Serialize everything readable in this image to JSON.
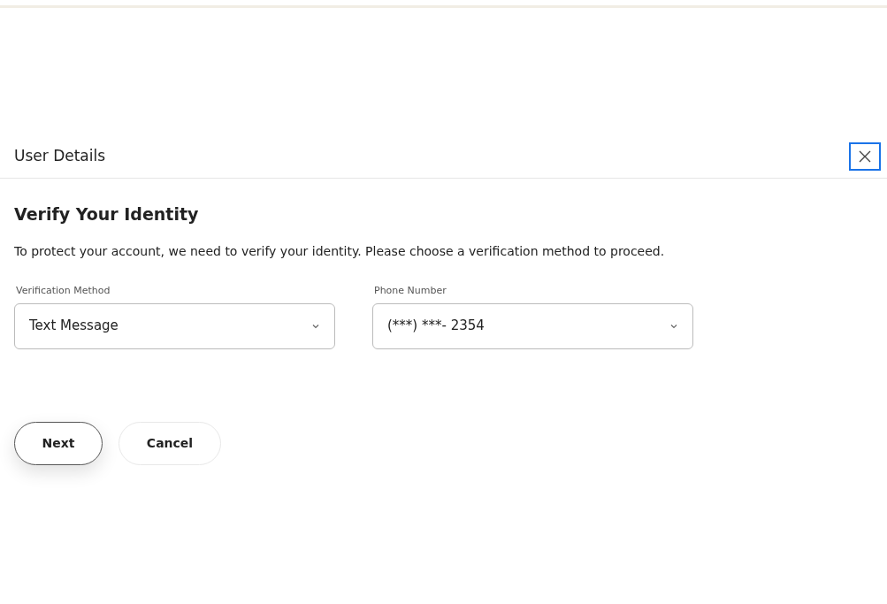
{
  "dialog": {
    "title": "User Details"
  },
  "heading": "Verify Your Identity",
  "description": "To protect your account, we need to verify your identity. Please choose a verification method to proceed.",
  "fields": [
    {
      "label": "Verification Method",
      "value": "Text Message"
    },
    {
      "label": "Phone Number",
      "value": "(***) ***- 2354"
    }
  ],
  "buttons": [
    {
      "label": "Next",
      "focused": true
    },
    {
      "label": "Cancel",
      "focused": false
    }
  ]
}
